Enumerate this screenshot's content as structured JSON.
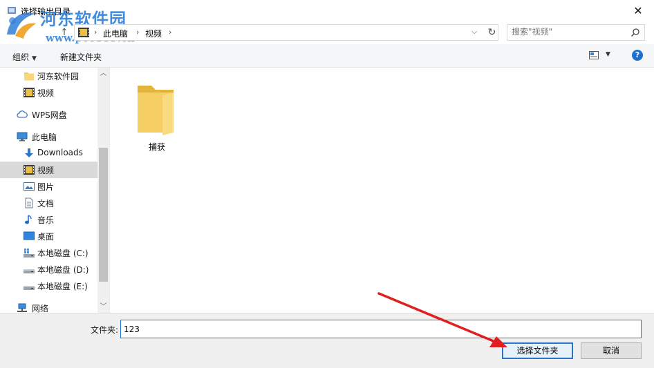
{
  "window": {
    "title": "选择输出目录",
    "close_glyph": "✕"
  },
  "watermark": {
    "site_name": "河东软件园",
    "url": "www.pc0359.cn"
  },
  "address": {
    "breadcrumbs": [
      "此电脑",
      "视频"
    ],
    "search_placeholder": "搜索\"视频\""
  },
  "toolbar": {
    "organize_label": "组织",
    "new_folder_label": "新建文件夹",
    "help_glyph": "?"
  },
  "nav": {
    "items": [
      {
        "label": "河东软件园",
        "icon": "folder-icon"
      },
      {
        "label": "视频",
        "icon": "video-icon"
      },
      {
        "label": "WPS网盘",
        "icon": "cloud-icon"
      },
      {
        "label": "此电脑",
        "icon": "computer-icon"
      },
      {
        "label": "Downloads",
        "icon": "download-icon"
      },
      {
        "label": "视频",
        "icon": "video-icon",
        "selected": true
      },
      {
        "label": "图片",
        "icon": "pictures-icon"
      },
      {
        "label": "文档",
        "icon": "documents-icon"
      },
      {
        "label": "音乐",
        "icon": "music-icon"
      },
      {
        "label": "桌面",
        "icon": "desktop-icon"
      },
      {
        "label": "本地磁盘 (C:)",
        "icon": "system-drive-icon"
      },
      {
        "label": "本地磁盘 (D:)",
        "icon": "drive-icon"
      },
      {
        "label": "本地磁盘 (E:)",
        "icon": "drive-icon"
      },
      {
        "label": "网络",
        "icon": "network-icon"
      }
    ]
  },
  "content": {
    "folders": [
      {
        "name": "捕获"
      }
    ]
  },
  "footer": {
    "folder_label": "文件夹:",
    "folder_value": "123",
    "select_button": "选择文件夹",
    "cancel_button": "取消"
  },
  "colors": {
    "accent": "#1a78d6",
    "folder": "#f3c95a",
    "annotation_arrow": "#e02020",
    "watermark": "#2f7fd8"
  }
}
